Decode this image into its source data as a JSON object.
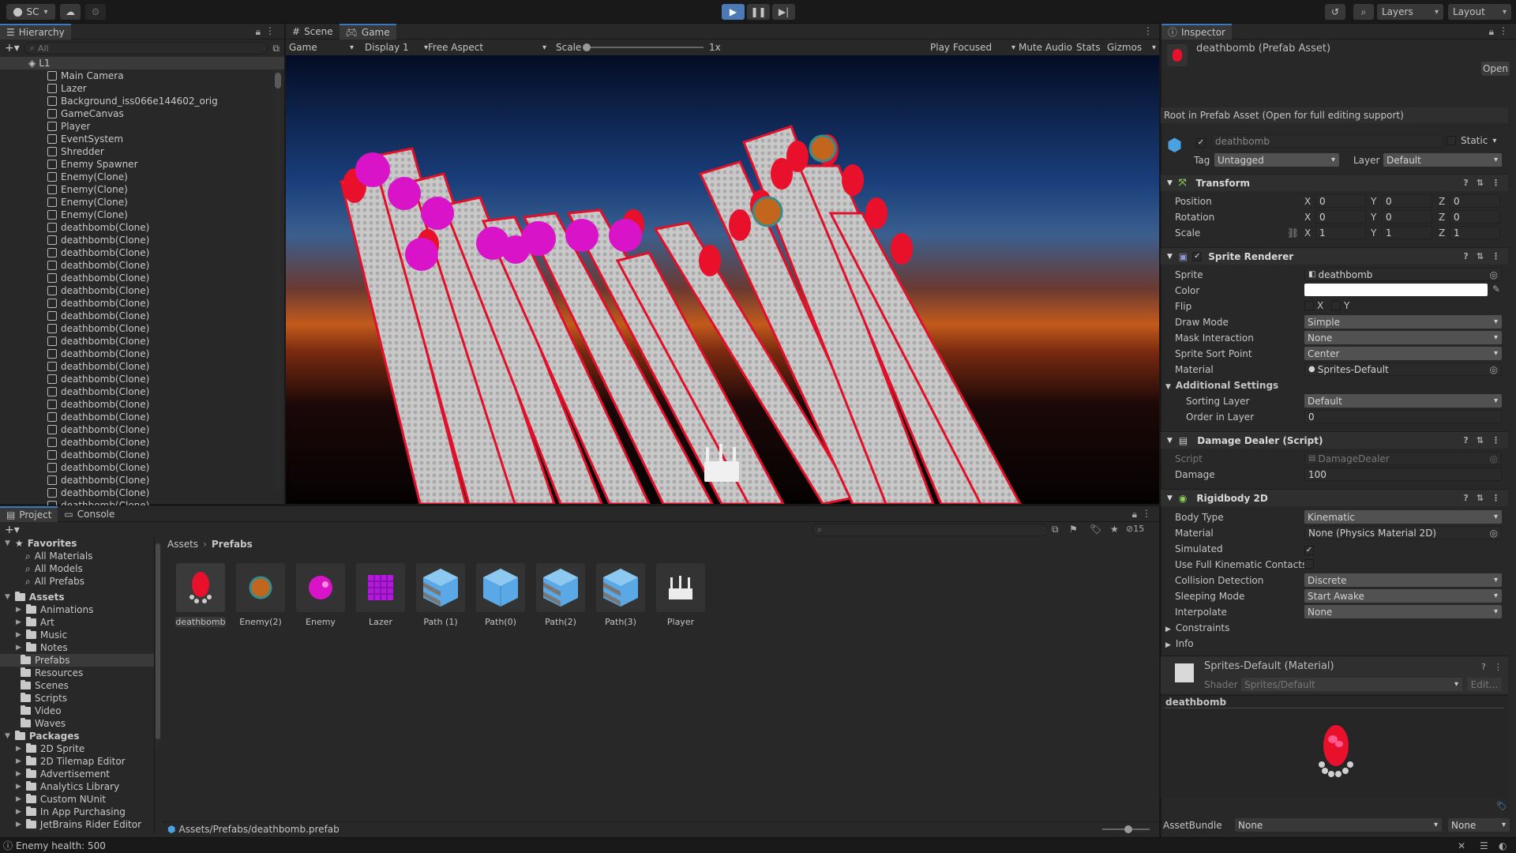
{
  "toolbar": {
    "account": "SC",
    "layers": "Layers",
    "layout": "Layout"
  },
  "hierarchy": {
    "tab": "Hierarchy",
    "search_placeholder": "All",
    "scene": "L1",
    "items": [
      "Main Camera",
      "Lazer",
      "Background_iss066e144602_orig",
      "GameCanvas",
      "Player",
      "EventSystem",
      "Shredder",
      "Enemy Spawner",
      "Enemy(Clone)",
      "Enemy(Clone)",
      "Enemy(Clone)",
      "Enemy(Clone)",
      "deathbomb(Clone)",
      "deathbomb(Clone)",
      "deathbomb(Clone)",
      "deathbomb(Clone)",
      "deathbomb(Clone)",
      "deathbomb(Clone)",
      "deathbomb(Clone)",
      "deathbomb(Clone)",
      "deathbomb(Clone)",
      "deathbomb(Clone)",
      "deathbomb(Clone)",
      "deathbomb(Clone)",
      "deathbomb(Clone)",
      "deathbomb(Clone)",
      "deathbomb(Clone)",
      "deathbomb(Clone)",
      "deathbomb(Clone)",
      "deathbomb(Clone)",
      "deathbomb(Clone)",
      "deathbomb(Clone)",
      "deathbomb(Clone)",
      "deathbomb(Clone)",
      "deathbomb(Clone)"
    ]
  },
  "game": {
    "tabs": [
      "Scene",
      "Game"
    ],
    "mode": "Game",
    "display": "Display 1",
    "aspect": "Free Aspect",
    "scale_label": "Scale",
    "scale_value": "1x",
    "play_focused": "Play Focused",
    "mute": "Mute Audio",
    "stats": "Stats",
    "gizmos": "Gizmos"
  },
  "inspector": {
    "tab": "Inspector",
    "asset_title": "deathbomb (Prefab Asset)",
    "open": "Open",
    "root_note": "Root in Prefab Asset (Open for full editing support)",
    "name": "deathbomb",
    "static": "Static",
    "tag_label": "Tag",
    "tag_value": "Untagged",
    "layer_label": "Layer",
    "layer_value": "Default",
    "transform": {
      "title": "Transform",
      "position": "Position",
      "rotation": "Rotation",
      "scale": "Scale",
      "x": "X",
      "y": "Y",
      "z": "Z",
      "pos": [
        "0",
        "0",
        "0"
      ],
      "rot": [
        "0",
        "0",
        "0"
      ],
      "scl": [
        "1",
        "1",
        "1"
      ]
    },
    "sprite_renderer": {
      "title": "Sprite Renderer",
      "sprite_label": "Sprite",
      "sprite_value": "deathbomb",
      "color_label": "Color",
      "flip_label": "Flip",
      "flip_x": "X",
      "flip_y": "Y",
      "draw_mode_label": "Draw Mode",
      "draw_mode": "Simple",
      "mask_label": "Mask Interaction",
      "mask": "None",
      "sort_point_label": "Sprite Sort Point",
      "sort_point": "Center",
      "material_label": "Material",
      "material": "Sprites-Default",
      "additional": "Additional Settings",
      "sorting_layer_label": "Sorting Layer",
      "sorting_layer": "Default",
      "order_label": "Order in Layer",
      "order": "0"
    },
    "damage_dealer": {
      "title": "Damage Dealer (Script)",
      "script_label": "Script",
      "script": "DamageDealer",
      "damage_label": "Damage",
      "damage": "100"
    },
    "rigidbody": {
      "title": "Rigidbody 2D",
      "body_type_label": "Body Type",
      "body_type": "Kinematic",
      "material_label": "Material",
      "material": "None (Physics Material 2D)",
      "simulated_label": "Simulated",
      "full_kinematic_label": "Use Full Kinematic Contacts",
      "collision_label": "Collision Detection",
      "collision": "Discrete",
      "sleeping_label": "Sleeping Mode",
      "sleeping": "Start Awake",
      "interpolate_label": "Interpolate",
      "interpolate": "None",
      "constraints": "Constraints",
      "info": "Info"
    },
    "material_block": {
      "title": "Sprites-Default (Material)",
      "shader_label": "Shader",
      "shader": "Sprites/Default",
      "edit": "Edit..."
    },
    "preview_title": "deathbomb",
    "assetbundle_label": "AssetBundle",
    "assetbundle_value": "None",
    "assetbundle_variant": "None"
  },
  "project": {
    "tabs": [
      "Project",
      "Console"
    ],
    "favorites": "Favorites",
    "fav_items": [
      "All Materials",
      "All Models",
      "All Prefabs"
    ],
    "assets": "Assets",
    "asset_folders": [
      "Animations",
      "Art",
      "Music",
      "Notes",
      "Prefabs",
      "Resources",
      "Scenes",
      "Scripts",
      "Video",
      "Waves"
    ],
    "packages": "Packages",
    "package_folders": [
      "2D Sprite",
      "2D Tilemap Editor",
      "Advertisement",
      "Analytics Library",
      "Custom NUnit",
      "In App Purchasing",
      "JetBrains Rider Editor"
    ],
    "breadcrumb": [
      "Assets",
      "Prefabs"
    ],
    "hidden_count": "15",
    "items": [
      "deathbomb",
      "Enemy(2)",
      "Enemy",
      "Lazer",
      "Path (1)",
      "Path(0)",
      "Path(2)",
      "Path(3)",
      "Player"
    ],
    "path": "Assets/Prefabs/deathbomb.prefab"
  },
  "status": {
    "message": "Enemy health: 500"
  }
}
